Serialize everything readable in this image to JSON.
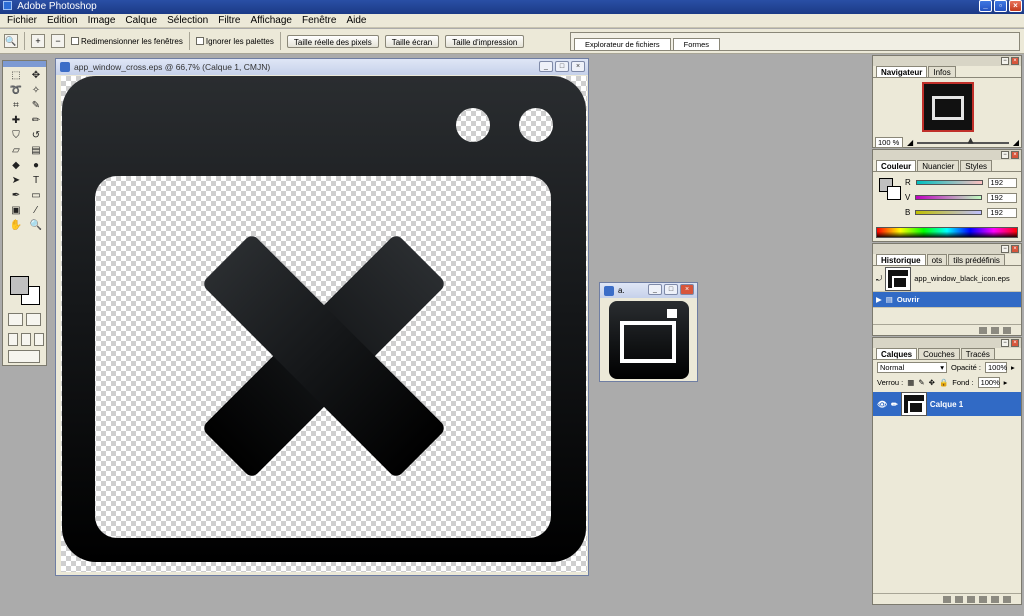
{
  "app": {
    "title": "Adobe Photoshop"
  },
  "menu": [
    "Fichier",
    "Edition",
    "Image",
    "Calque",
    "Sélection",
    "Filtre",
    "Affichage",
    "Fenêtre",
    "Aide"
  ],
  "options": {
    "resize_windows": "Redimensionner les fenêtres",
    "ignore_palettes": "Ignorer les palettes",
    "actual_pixels": "Taille réelle des pixels",
    "fit_screen": "Taille écran",
    "print_size": "Taille d'impression"
  },
  "well": {
    "tab1": "Explorateur de fichiers",
    "tab2": "Formes"
  },
  "document": {
    "title": "app_window_cross.eps @ 66,7% (Calque 1, CMJN)"
  },
  "small_window": {
    "title": "a."
  },
  "navigator": {
    "tab_active": "Navigateur",
    "tab2": "Infos",
    "zoom": "100 %"
  },
  "color": {
    "tab_active": "Couleur",
    "tab2": "Nuancier",
    "tab3": "Styles",
    "channels": [
      {
        "label": "R",
        "value": "192"
      },
      {
        "label": "V",
        "value": "192"
      },
      {
        "label": "B",
        "value": "192"
      }
    ]
  },
  "history": {
    "tab_active": "Historique",
    "tab2": "ots",
    "tab3": "tils prédéfinis",
    "snapshot": "app_window_black_icon.eps",
    "step": "Ouvrir"
  },
  "layers": {
    "tab_active": "Calques",
    "tab2": "Couches",
    "tab3": "Tracés",
    "blend_mode": "Normal",
    "opacity_label": "Opacité :",
    "opacity": "100%",
    "lock_label": "Verrou :",
    "fill_label": "Fond :",
    "fill": "100%",
    "layer_name": "Calque 1"
  }
}
